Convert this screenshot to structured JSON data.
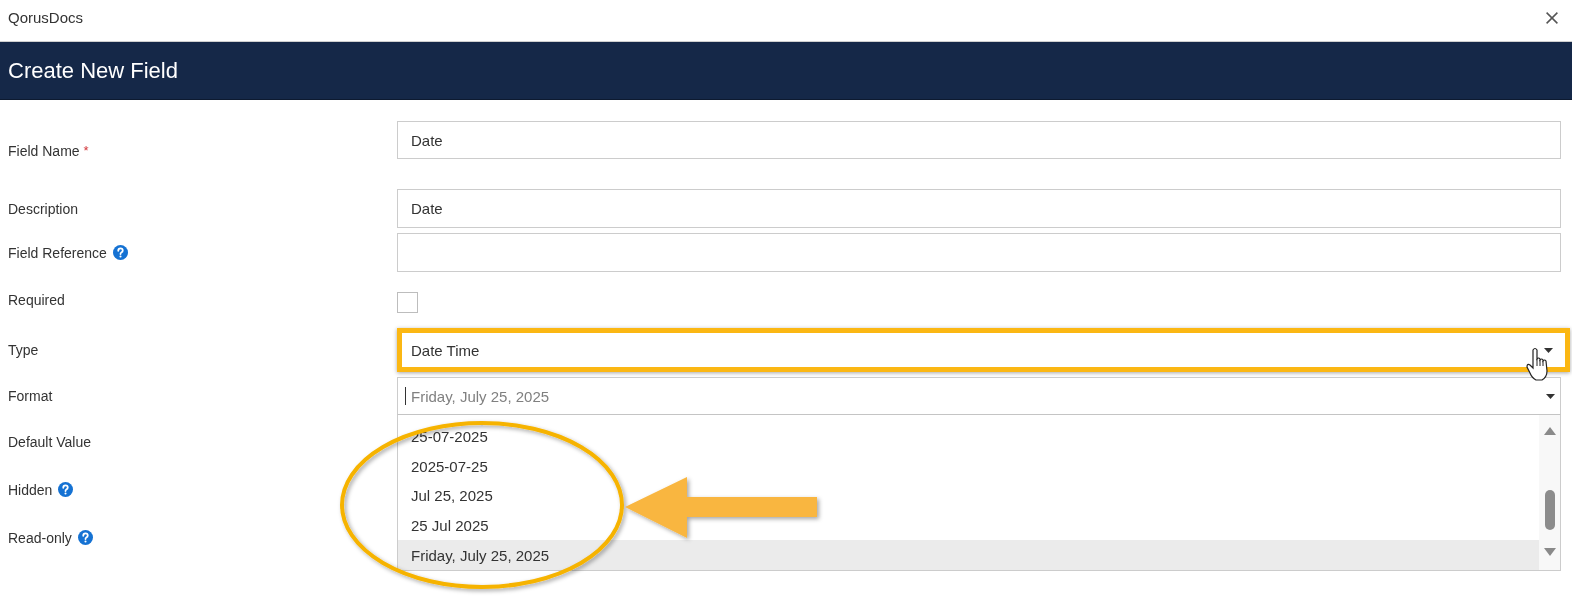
{
  "window": {
    "title": "QorusDocs"
  },
  "header": {
    "title": "Create New Field"
  },
  "form": {
    "rows": [
      {
        "label": "Field Name",
        "required_mark": "*",
        "help": false,
        "control": {
          "kind": "text",
          "value": "Date"
        }
      },
      {
        "label": "Description",
        "help": false,
        "control": {
          "kind": "text",
          "value": "Date"
        }
      },
      {
        "label": "Field Reference",
        "help": true,
        "control": {
          "kind": "text"
        }
      },
      {
        "label": "Required",
        "help": false,
        "control": {
          "kind": "checkbox",
          "checked": false
        }
      },
      {
        "label": "Type",
        "help": false,
        "control": {
          "kind": "select",
          "value": "Date Time",
          "highlighted": true
        }
      },
      {
        "label": "Format",
        "help": false,
        "control": {
          "kind": "combobox",
          "placeholder": "Friday, July 25, 2025",
          "focused": true,
          "expanded": true,
          "options": [
            {
              "label": "25-07-2025",
              "selected": false
            },
            {
              "label": "2025-07-25",
              "selected": false
            },
            {
              "label": "Jul 25, 2025",
              "selected": false
            },
            {
              "label": "25 Jul 2025",
              "selected": false
            },
            {
              "label": "Friday, July 25, 2025",
              "selected": true
            }
          ]
        }
      },
      {
        "label": "Default Value",
        "help": false
      },
      {
        "label": "Hidden",
        "help": true
      },
      {
        "label": "Read-only",
        "help": true
      }
    ]
  },
  "annotations": [
    {
      "kind": "ellipse"
    },
    {
      "kind": "arrow"
    }
  ],
  "cursor": {
    "kind": "hand"
  }
}
